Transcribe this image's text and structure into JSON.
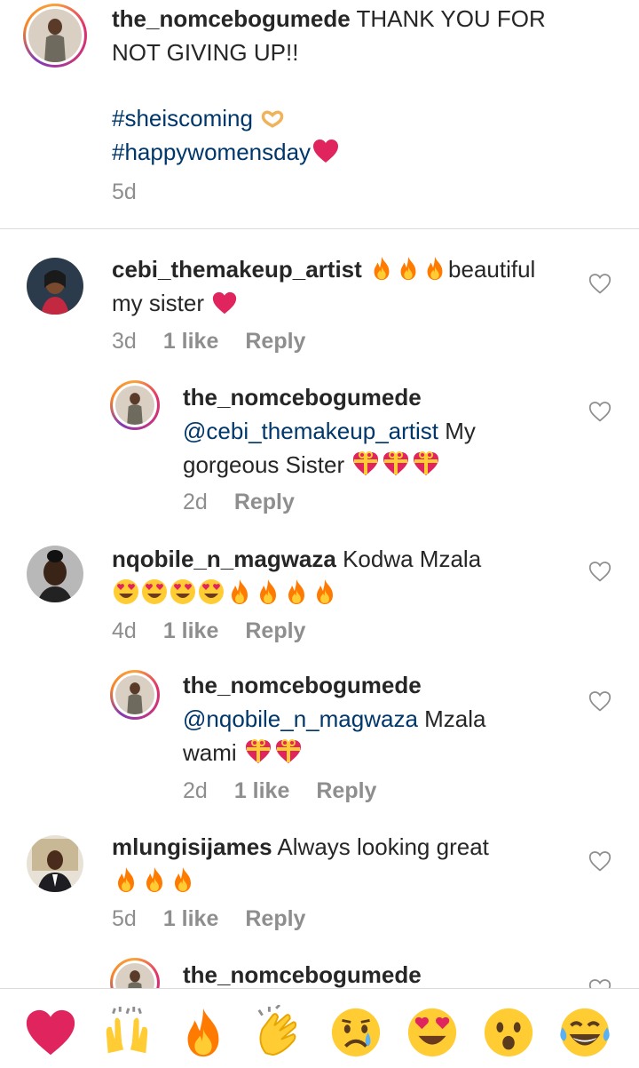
{
  "caption": {
    "username": "the_nomcebogumede",
    "text_line1": "THANK YOU FOR",
    "text_line2": "NOT GIVING UP!!",
    "hashtag1": "#sheiscoming",
    "hashtag2": "#happywomensday",
    "time": "5d"
  },
  "comments": [
    {
      "username": "cebi_themakeup_artist",
      "text_a": "beautiful",
      "text_b": "my sister",
      "time": "3d",
      "likes": "1 like",
      "reply": "Reply"
    },
    {
      "username": "the_nomcebogumede",
      "mention": "@cebi_themakeup_artist",
      "text_a": "My",
      "text_b": "gorgeous Sister",
      "time": "2d",
      "reply": "Reply"
    },
    {
      "username": "nqobile_n_magwaza",
      "text_a": "Kodwa Mzala",
      "time": "4d",
      "likes": "1 like",
      "reply": "Reply"
    },
    {
      "username": "the_nomcebogumede",
      "mention": "@nqobile_n_magwaza",
      "text_a": "Mzala",
      "text_b": "wami",
      "time": "2d",
      "likes": "1 like",
      "reply": "Reply"
    },
    {
      "username": "mlungisijames",
      "text_a": "Always looking great",
      "time": "5d",
      "likes": "1 like",
      "reply": "Reply"
    },
    {
      "username": "the_nomcebogumede"
    }
  ],
  "emoji_bar": [
    "red-heart",
    "raising-hands",
    "fire",
    "clapping-hands",
    "crying-face",
    "heart-eyes",
    "surprised-face",
    "tears-of-joy"
  ],
  "colors": {
    "hashtag": "#00376b",
    "meta": "#8e8e8e",
    "heart": "#e0245e",
    "fire": "#ff7a00"
  }
}
